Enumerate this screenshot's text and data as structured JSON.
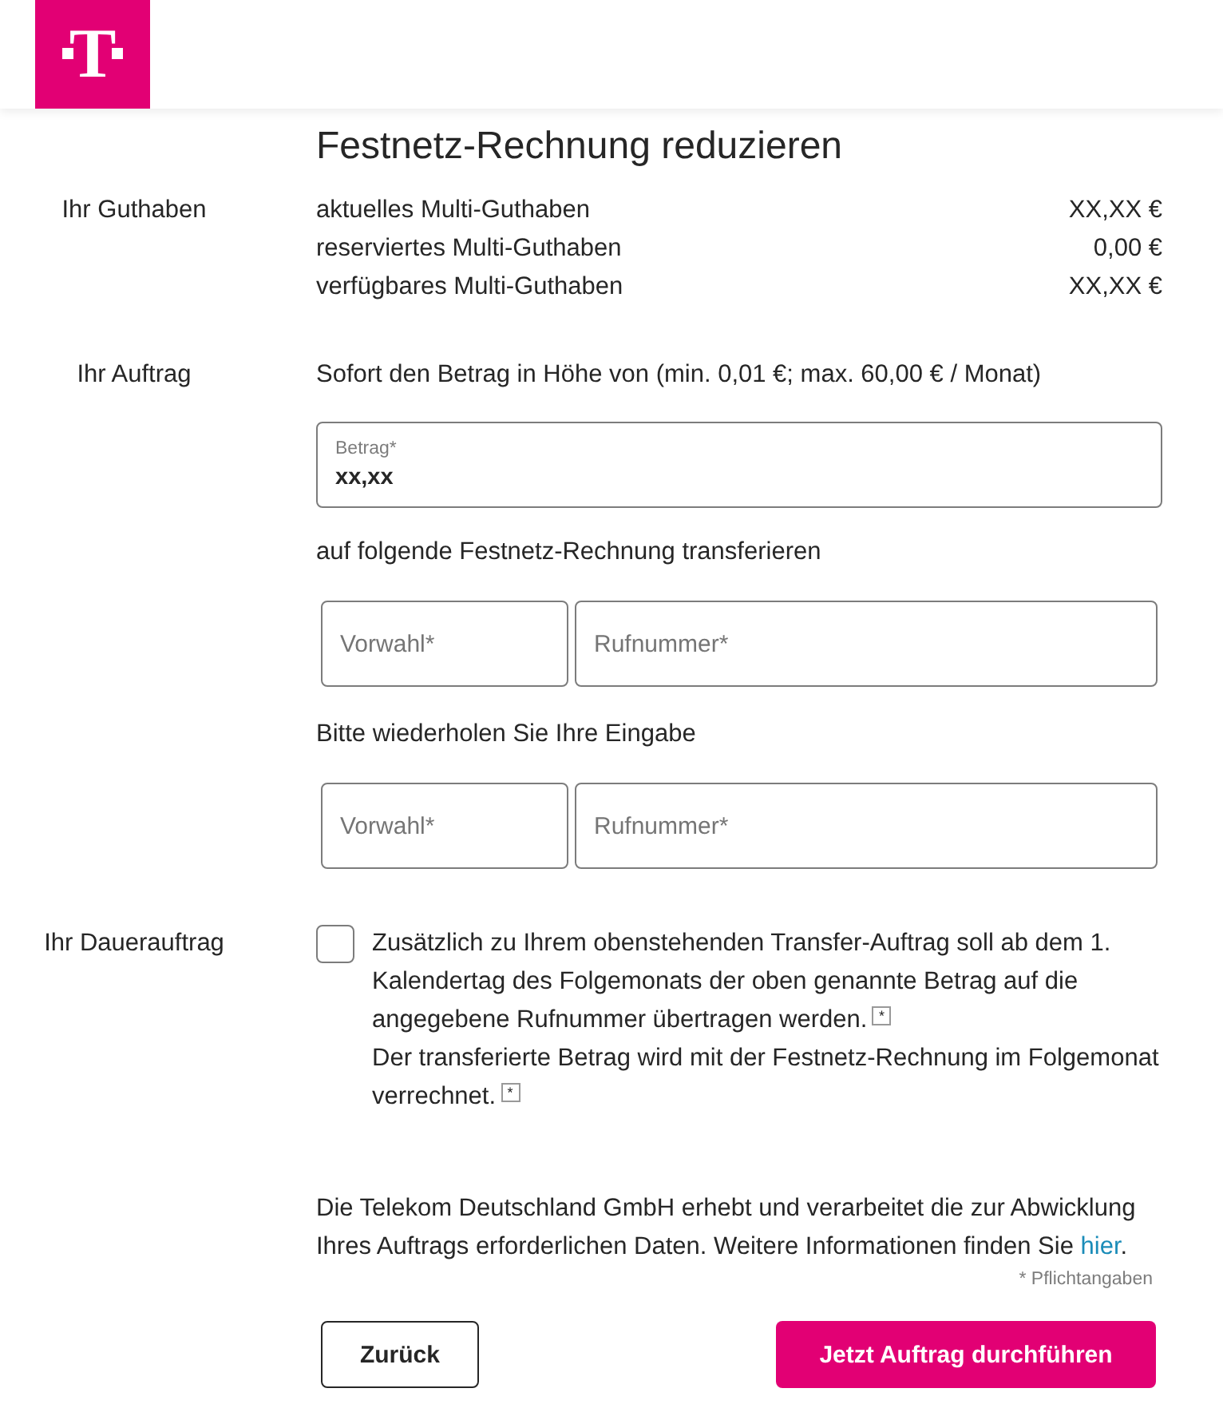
{
  "header": {
    "logo": "T"
  },
  "title": "Festnetz-Rechnung reduzieren",
  "balance": {
    "label": "Ihr Guthaben",
    "rows": [
      {
        "name": "aktuelles Multi-Guthaben",
        "value": "XX,XX €"
      },
      {
        "name": "reserviertes Multi-Guthaben",
        "value": "0,00 €"
      },
      {
        "name": "verfügbares Multi-Guthaben",
        "value": "XX,XX €"
      }
    ]
  },
  "order": {
    "label": "Ihr Auftrag",
    "intro": "Sofort den Betrag in Höhe von (min. 0,01 €; max. 60,00 € / Monat)",
    "amount": {
      "label": "Betrag*",
      "value": "xx,xx"
    },
    "transfer_text": "auf folgende Festnetz-Rechnung transferieren",
    "phone": {
      "area_placeholder": "Vorwahl*",
      "number_placeholder": "Rufnummer*"
    },
    "repeat_text": "Bitte wiederholen Sie Ihre Eingabe",
    "phone_repeat": {
      "area_placeholder": "Vorwahl*",
      "number_placeholder": "Rufnummer*"
    }
  },
  "standing_order": {
    "label": "Ihr Dauerauftrag",
    "checked": false,
    "parts": [
      {
        "text": "Zusätzlich zu Ihrem obenstehenden Transfer-Auftrag soll ab dem 1. Kalendertag des Folgemonats der oben genannte Betrag auf die angegebene Rufnummer übertragen werden.",
        "note": "*"
      },
      {
        "text": "Der transferierte Betrag wird mit der Festnetz-Rechnung im Folgemonat verrechnet.",
        "note": "*"
      }
    ]
  },
  "privacy": {
    "text": "Die Telekom Deutschland GmbH erhebt und verarbeitet die zur Abwicklung Ihres Auftrags erforderlichen Daten. Weitere Informationen finden Sie",
    "link": "hier",
    "after": "."
  },
  "required_note": "* Pflichtangaben",
  "buttons": {
    "back": "Zurück",
    "submit": "Jetzt Auftrag durchführen"
  }
}
